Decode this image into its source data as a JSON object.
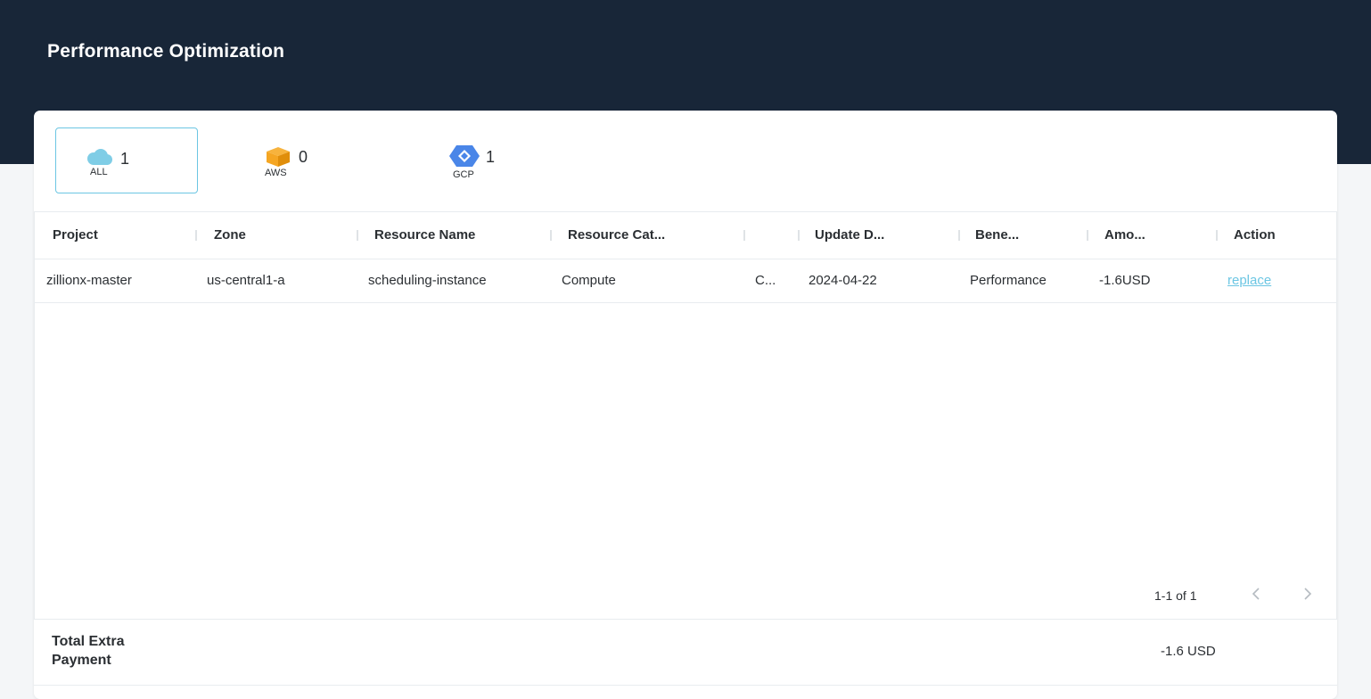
{
  "header": {
    "title": "Performance Optimization"
  },
  "providers": [
    {
      "label": "ALL",
      "count": "1",
      "icon": "cloud-icon",
      "selected": true
    },
    {
      "label": "AWS",
      "count": "0",
      "icon": "aws-box-icon",
      "selected": false
    },
    {
      "label": "GCP",
      "count": "1",
      "icon": "gcp-hexagon-icon",
      "selected": false
    }
  ],
  "table": {
    "columns": [
      "Project",
      "Zone",
      "Resource Name",
      "Resource Cat...",
      "",
      "Update D...",
      "Bene...",
      "Amo...",
      "Action"
    ],
    "rows": [
      {
        "project": "zillionx-master",
        "zone": "us-central1-a",
        "resource_name": "scheduling-instance",
        "resource_category": "Compute",
        "col5": "C...",
        "update_date": "2024-04-22",
        "benefit": "Performance",
        "amount": "-1.6USD",
        "action": "replace"
      }
    ]
  },
  "pagination": {
    "text": "1-1 of 1"
  },
  "footer": {
    "label": "Total Extra Payment",
    "value": "-1.6 USD"
  },
  "colors": {
    "header_bg": "#182638",
    "accent": "#6cc6e3",
    "aws_orange": "#f5a623",
    "gcp_blue": "#4a86e8"
  }
}
